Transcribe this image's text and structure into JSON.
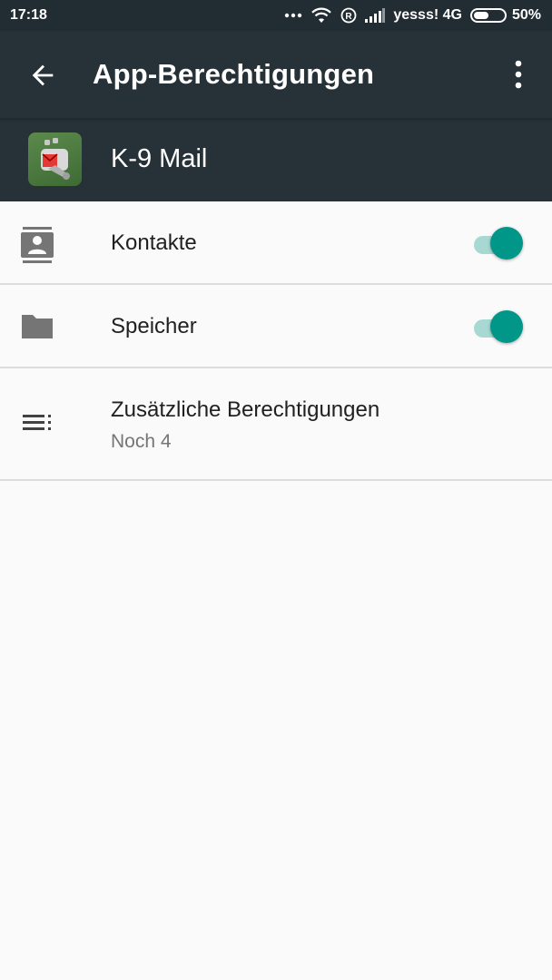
{
  "status_bar": {
    "time": "17:18",
    "carrier": "yesss! 4G",
    "battery_percent": "50%",
    "battery_level": 0.5,
    "icons": [
      "more-dots-icon",
      "wifi-icon",
      "roaming-icon",
      "signal-icon",
      "battery-icon"
    ]
  },
  "app_bar": {
    "title": "App-Berechtigungen",
    "back_icon": "arrow-back-icon",
    "menu_icon": "more-vert-icon"
  },
  "app": {
    "name": "K-9 Mail",
    "icon": "k9-mail-icon"
  },
  "permissions": [
    {
      "label": "Kontakte",
      "icon": "contacts-icon",
      "enabled": true
    },
    {
      "label": "Speicher",
      "icon": "folder-icon",
      "enabled": true
    }
  ],
  "additional": {
    "label": "Zusätzliche Berechtigungen",
    "sublabel": "Noch 4",
    "icon": "list-icon"
  },
  "colors": {
    "app_bar": "#263238",
    "status_bar": "#222c33",
    "accent": "#009688",
    "track": "#a8d8d2",
    "background": "#fafafa"
  }
}
